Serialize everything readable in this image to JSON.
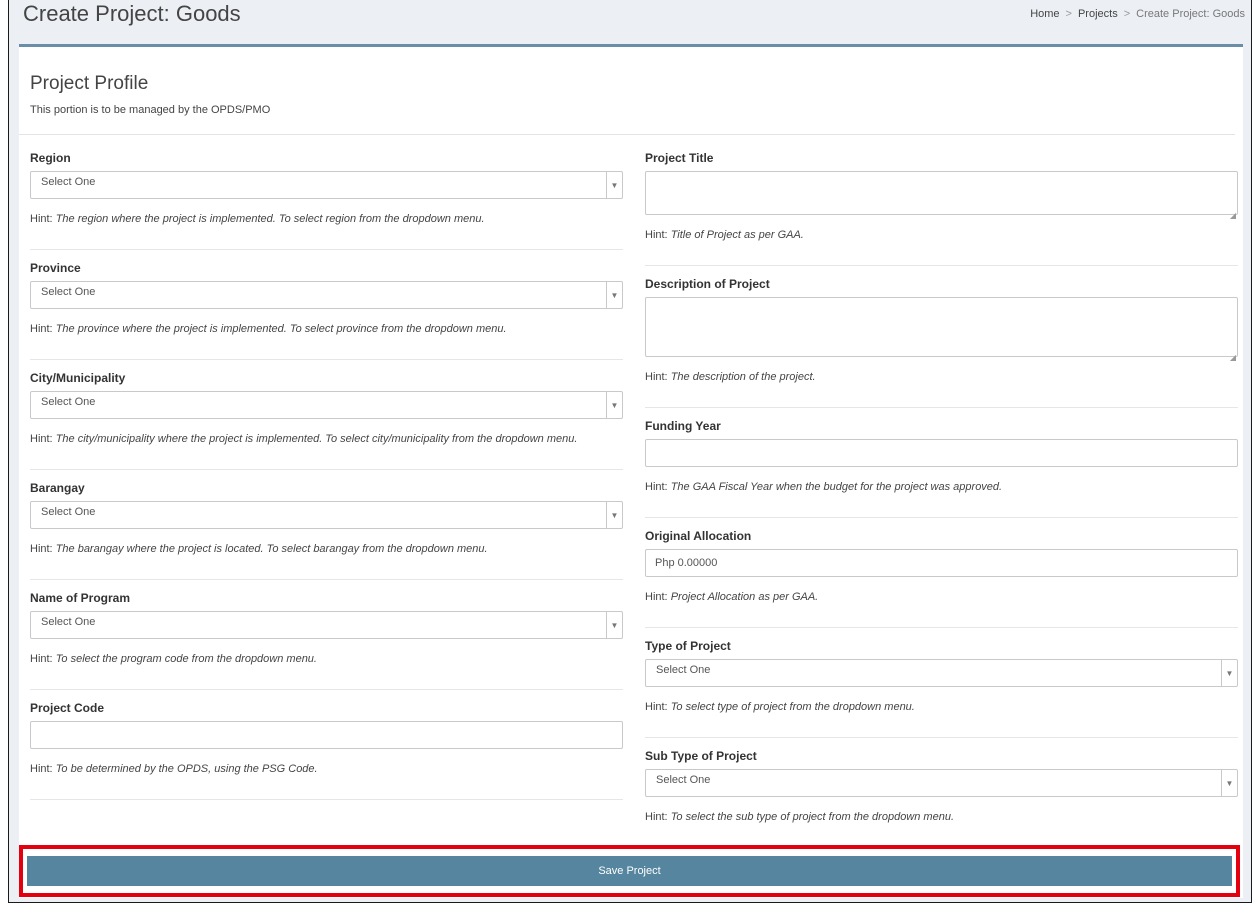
{
  "header": {
    "title": "Create Project: Goods",
    "breadcrumb": [
      "Home",
      "Projects",
      "Create Project: Goods"
    ],
    "separator": ">"
  },
  "profile": {
    "title": "Project Profile",
    "subtitle": "This portion is to be managed by the OPDS/PMO"
  },
  "hint_prefix": "Hint:",
  "left_fields": {
    "region": {
      "label": "Region",
      "value": "Select One",
      "hint": "The region where the project is implemented. To select region from the dropdown menu."
    },
    "province": {
      "label": "Province",
      "value": "Select One",
      "hint": "The province where the project is implemented. To select province from the dropdown menu."
    },
    "city": {
      "label": "City/Municipality",
      "value": "Select One",
      "hint": "The city/municipality where the project is implemented. To select city/municipality from the dropdown menu."
    },
    "barangay": {
      "label": "Barangay",
      "value": "Select One",
      "hint": "The barangay where the project is located. To select barangay from the dropdown menu."
    },
    "program": {
      "label": "Name of Program",
      "value": "Select One",
      "hint": "To select the program code from the dropdown menu."
    },
    "project_code": {
      "label": "Project Code",
      "value": "",
      "hint": "To be determined by the OPDS, using the PSG Code."
    }
  },
  "right_fields": {
    "title": {
      "label": "Project Title",
      "value": "",
      "hint": "Title of Project as per GAA."
    },
    "description": {
      "label": "Description of Project",
      "value": "",
      "hint": "The description of the project."
    },
    "funding_year": {
      "label": "Funding Year",
      "value": "",
      "hint": "The GAA Fiscal Year when the budget for the project was approved."
    },
    "allocation": {
      "label": "Original Allocation",
      "value": "Php 0.00000",
      "hint": "Project Allocation as per GAA."
    },
    "type": {
      "label": "Type of Project",
      "value": "Select One",
      "hint": "To select type of project from the dropdown menu."
    },
    "sub_type": {
      "label": "Sub Type of Project",
      "value": "Select One",
      "hint": "To select the sub type of project from the dropdown menu."
    }
  },
  "save_label": "Save Project",
  "colors": {
    "accent": "#55859f",
    "highlight": "#e3000f"
  }
}
